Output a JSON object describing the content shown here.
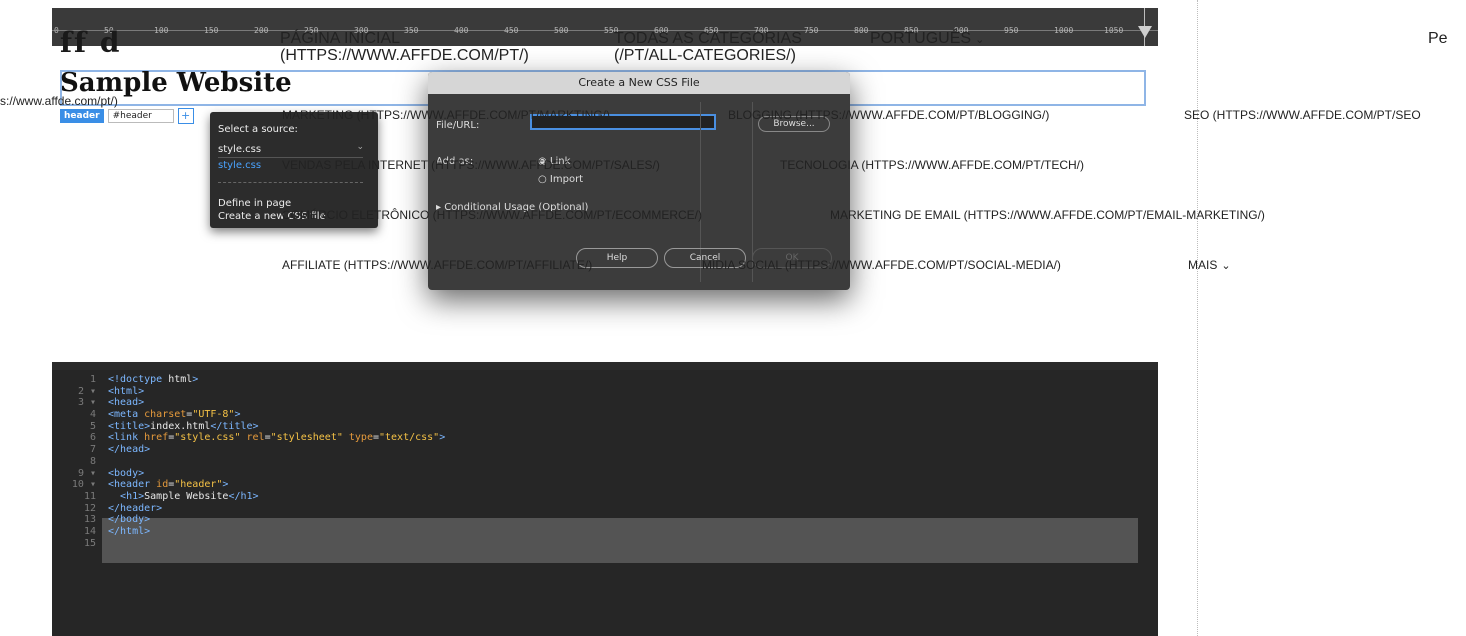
{
  "screenshot": {
    "ruler": {
      "ticks": [
        {
          "label": "0"
        },
        {
          "label": "50"
        },
        {
          "label": "100"
        },
        {
          "label": "150"
        },
        {
          "label": "200"
        },
        {
          "label": "250"
        },
        {
          "label": "300"
        },
        {
          "label": "350"
        },
        {
          "label": "400"
        },
        {
          "label": "450"
        },
        {
          "label": "500"
        },
        {
          "label": "550"
        },
        {
          "label": "600"
        },
        {
          "label": "650"
        },
        {
          "label": "700"
        },
        {
          "label": "750"
        },
        {
          "label": "800"
        },
        {
          "label": "850"
        },
        {
          "label": "900"
        },
        {
          "label": "950"
        },
        {
          "label": "1000"
        },
        {
          "label": "1050"
        }
      ]
    },
    "page_heading": "Sample Website",
    "tag_chip": "header",
    "tag_selector": "#header",
    "add_button": "+",
    "source_popup": {
      "title": "Select a source:",
      "selected": "style.css",
      "highlighted": "style.css",
      "define_in_page": "Define in page",
      "create_new": "Create a new CSS file"
    },
    "dialog": {
      "title": "Create a New CSS File",
      "file_url_label": "File/URL:",
      "browse": "Browse...",
      "add_as_label": "Add as:",
      "option_link": "Link",
      "option_import": "Import",
      "conditional_usage": "Conditional Usage (Optional)",
      "help": "Help",
      "cancel": "Cancel",
      "ok": "OK"
    },
    "code": [
      {
        "n": "1",
        "text": "<!doctype html>"
      },
      {
        "n": "2 ▾",
        "text": "<html>"
      },
      {
        "n": "3 ▾",
        "text": "<head>"
      },
      {
        "n": "4",
        "text": "<meta charset=\"UTF-8\">"
      },
      {
        "n": "5",
        "text": "<title>index.html</title>"
      },
      {
        "n": "6",
        "text": "<link href=\"style.css\" rel=\"stylesheet\" type=\"text/css\">"
      },
      {
        "n": "7",
        "text": "</head>"
      },
      {
        "n": "8",
        "text": ""
      },
      {
        "n": "9 ▾",
        "text": "<body>"
      },
      {
        "n": "10 ▾",
        "text": "<header id=\"header\">"
      },
      {
        "n": "11",
        "text": "  <h1>Sample Website</h1>"
      },
      {
        "n": "12",
        "text": "</header>"
      },
      {
        "n": "13",
        "text": "</body>"
      },
      {
        "n": "14",
        "text": "</html>"
      },
      {
        "n": "15",
        "text": ""
      }
    ]
  },
  "site_link": "s://www.affde.com/pt/)",
  "nav": {
    "home": "PÁGINA INICIAL\n(HTTPS://WWW.AFFDE.COM/PT/)",
    "all_categories": "TODAS AS CATEGORIAS\n(/PT/ALL-CATEGORIES/)",
    "language": "PORTUGUÊS",
    "language_caret": "⌄",
    "search_cut": "Pe",
    "marketing": "MARKETING (HTTPS://WWW.AFFDE.COM/PT/MARKTING/)",
    "blogging": "BLOGGING (HTTPS://WWW.AFFDE.COM/PT/BLOGGING/)",
    "seo": "SEO (HTTPS://WWW.AFFDE.COM/PT/SEO",
    "sales": "VENDAS PELA INTERNET (HTTPS://WWW.AFFDE.COM/PT/SALES/)",
    "tech": "TECNOLOGIA (HTTPS://WWW.AFFDE.COM/PT/TECH/)",
    "ecommerce": "COMÉRCIO ELETRÔNICO (HTTPS://WWW.AFFDE.COM/PT/ECOMMERCE/)",
    "email_marketing": "MARKETING DE EMAIL (HTTPS://WWW.AFFDE.COM/PT/EMAIL-MARKETING/)",
    "affiliate": "AFFILIATE (HTTPS://WWW.AFFDE.COM/PT/AFFILIATE/)",
    "social_media": "MÍDIA SOCIAL (HTTPS://WWW.AFFDE.COM/PT/SOCIAL-MEDIA/)",
    "more": "MAIS",
    "more_caret": "⌄"
  }
}
